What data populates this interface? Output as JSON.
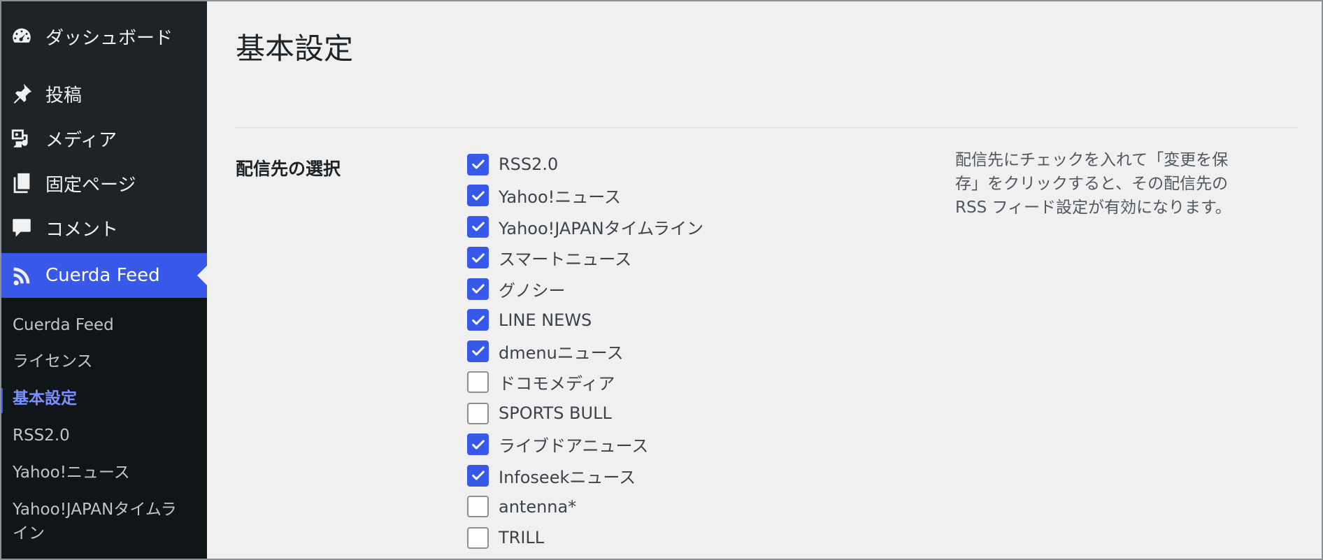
{
  "sidebar": {
    "menu": [
      {
        "label": "ダッシュボード",
        "icon": "dashboard-icon"
      },
      {
        "label": "投稿",
        "icon": "pin-icon"
      },
      {
        "label": "メディア",
        "icon": "media-icon"
      },
      {
        "label": "固定ページ",
        "icon": "pages-icon"
      },
      {
        "label": "コメント",
        "icon": "comment-icon"
      },
      {
        "label": "Cuerda Feed",
        "icon": "rss-icon"
      }
    ],
    "submenu": [
      {
        "label": "Cuerda Feed"
      },
      {
        "label": "ライセンス"
      },
      {
        "label": "基本設定"
      },
      {
        "label": "RSS2.0"
      },
      {
        "label": "Yahoo!ニュース"
      },
      {
        "label": "Yahoo!JAPANタイムラ"
      },
      {
        "label": "イン"
      }
    ]
  },
  "page": {
    "title": "基本設定",
    "field_label": "配信先の選択",
    "options": [
      {
        "label": "RSS2.0",
        "checked": true
      },
      {
        "label": "Yahoo!ニュース",
        "checked": true
      },
      {
        "label": "Yahoo!JAPANタイムライン",
        "checked": true
      },
      {
        "label": "スマートニュース",
        "checked": true
      },
      {
        "label": "グノシー",
        "checked": true
      },
      {
        "label": "LINE NEWS",
        "checked": true
      },
      {
        "label": "dmenuニュース",
        "checked": true
      },
      {
        "label": "ドコモメディア",
        "checked": false
      },
      {
        "label": "SPORTS BULL",
        "checked": false
      },
      {
        "label": "ライブドアニュース",
        "checked": true
      },
      {
        "label": "Infoseekニュース",
        "checked": true
      },
      {
        "label": "antenna*",
        "checked": false
      },
      {
        "label": "TRILL",
        "checked": false
      }
    ],
    "help_lines": [
      "配信先にチェックを入れて「変更を保",
      "存」をクリックすると、その配信先の",
      "RSS フィード設定が有効になります。"
    ]
  },
  "colors": {
    "accent": "#3858e9",
    "sidebar_bg": "#1d2327",
    "submenu_bg": "#101517",
    "page_bg": "#f0f0f1"
  }
}
